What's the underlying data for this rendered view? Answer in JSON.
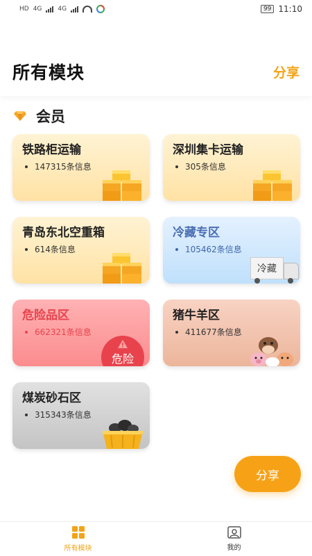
{
  "status_bar": {
    "left_text_1": "HD",
    "left_text_2": "4G",
    "left_text_3": "4G",
    "battery": "99",
    "time": "11:10"
  },
  "header": {
    "title": "所有模块",
    "share_label": "分享"
  },
  "section": {
    "title": "会员",
    "icon": "gem-icon",
    "icon_color": "#f5a623"
  },
  "cards": [
    {
      "title": "铁路柜运输",
      "count": "147315条信息",
      "theme": "yellow",
      "art": "boxes-icon"
    },
    {
      "title": "深圳集卡运输",
      "count": "305条信息",
      "theme": "yellow",
      "art": "boxes-icon"
    },
    {
      "title": "青岛东北空重箱",
      "count": "614条信息",
      "theme": "yellow",
      "art": "boxes-icon"
    },
    {
      "title": "冷藏专区",
      "count": "105462条信息",
      "theme": "blue",
      "art": "truck-icon",
      "art_text": "冷藏"
    },
    {
      "title": "危险品区",
      "count": "662321条信息",
      "theme": "red",
      "art": "danger-icon",
      "art_text": "危险"
    },
    {
      "title": "猪牛羊区",
      "count": "411677条信息",
      "theme": "brown",
      "art": "animals-icon"
    },
    {
      "title": "煤炭砂石区",
      "count": "315343条信息",
      "theme": "gray",
      "art": "coal-basket-icon"
    }
  ],
  "fab": {
    "label": "分享"
  },
  "bottom_nav": [
    {
      "label": "所有模块",
      "icon": "grid-icon",
      "active": true
    },
    {
      "label": "我的",
      "icon": "profile-icon",
      "active": false
    }
  ],
  "colors": {
    "accent": "#f2a419",
    "danger": "#e8434d",
    "cold": "#4a6fb3"
  }
}
